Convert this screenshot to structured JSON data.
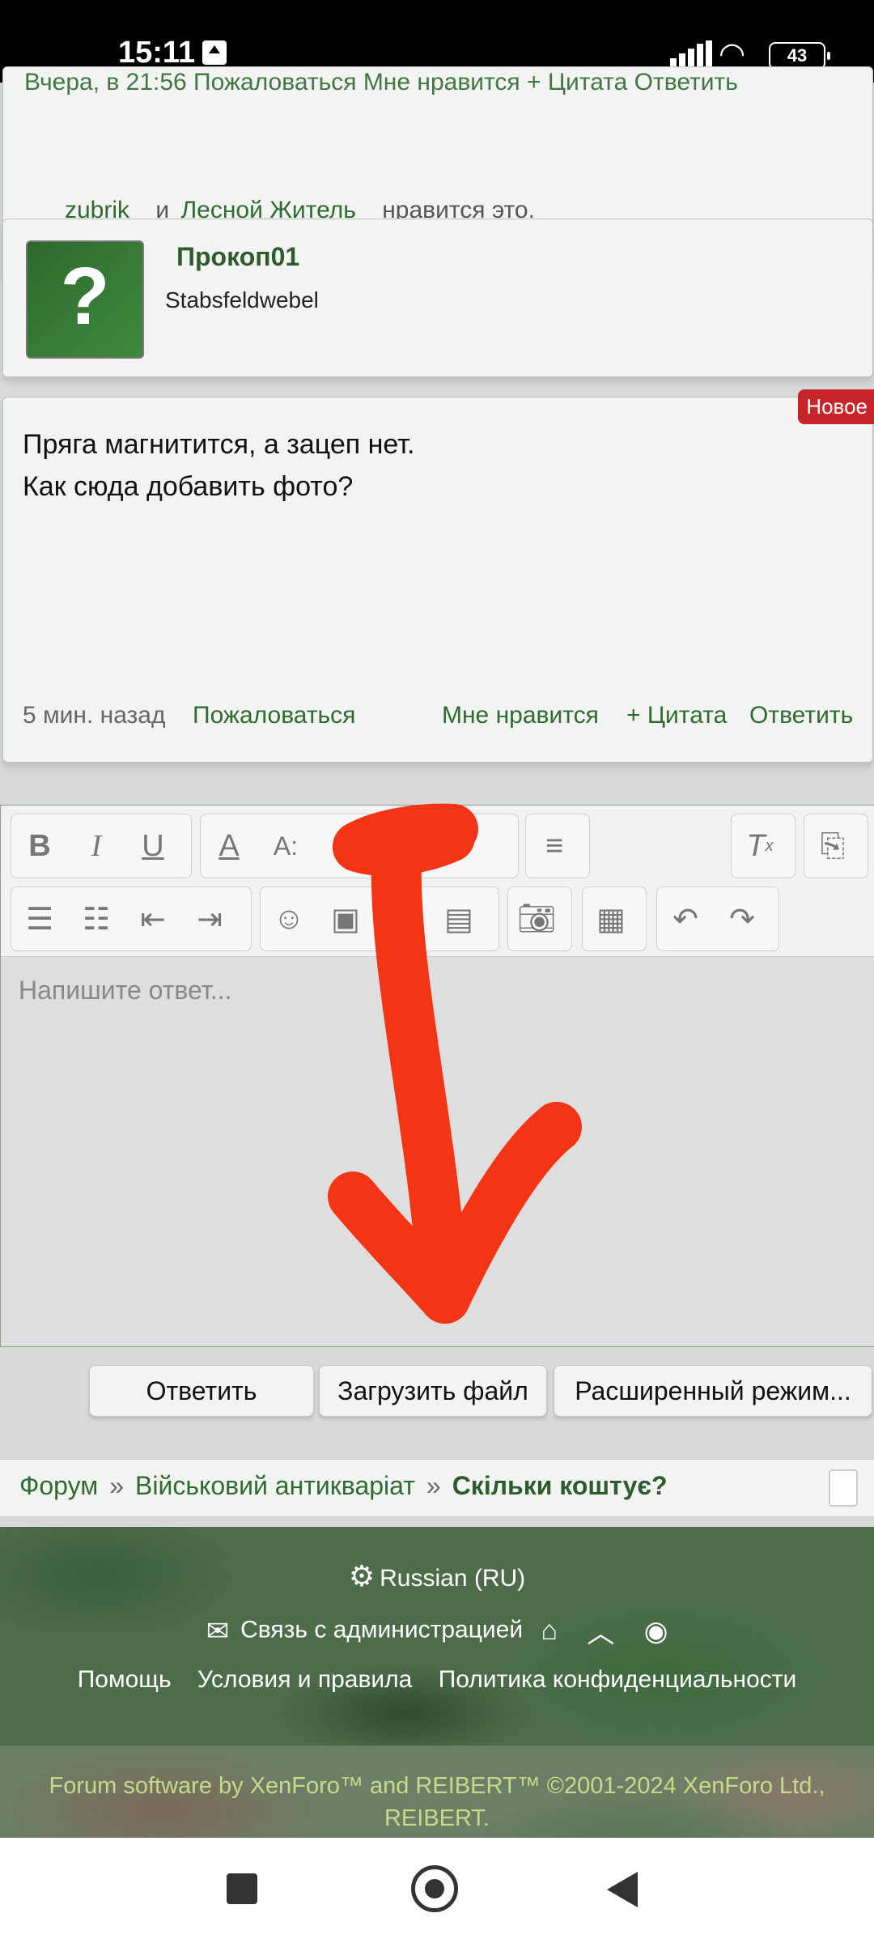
{
  "statusbar": {
    "time": "15:11",
    "battery": "43"
  },
  "likes": {
    "meta_cut": "Вчера, в 21:56   Пожаловаться        Мне нравится   + Цитата   Ответить",
    "user1": "zubrik",
    "joiner": "и",
    "user2": "Лесной Житель",
    "suffix": "нравится это."
  },
  "author": {
    "name": "Прокоп01",
    "title": "Stabsfeldwebel",
    "avatar_glyph": "?"
  },
  "post": {
    "badge": "Новое",
    "line1": "Пряга магнитится, а зацеп нет.",
    "line2": "Как сюда добавить фото?",
    "time": "5 мин. назад",
    "report": "Пожаловаться",
    "like": "Мне нравится",
    "quote": "+ Цитата",
    "reply": "Ответить"
  },
  "editor": {
    "placeholder": "Напишите ответ...",
    "toolbar_icons": [
      "bold-icon",
      "italic-icon",
      "underline-icon",
      "font-color-icon",
      "font-size-icon",
      "link-icon",
      "unlink-icon",
      "align-icon",
      "clear-format-icon",
      "source-icon",
      "bullet-list-icon",
      "numbered-list-icon",
      "outdent-icon",
      "indent-icon",
      "smiley-icon",
      "image-icon",
      "media-icon",
      "code-icon",
      "camera-icon",
      "save-icon",
      "undo-icon",
      "redo-icon"
    ]
  },
  "buttons": {
    "reply": "Ответить",
    "upload": "Загрузить файл",
    "advanced": "Расширенный режим..."
  },
  "breadcrumb": {
    "home": "Форум",
    "sep": "»",
    "section": "Військовий антикваріат",
    "current": "Скільки коштує?"
  },
  "footer": {
    "language": "Russian (RU)",
    "contact": "Связь с администрацией",
    "help": "Помощь",
    "terms": "Условия и правила",
    "privacy": "Политика конфиденциальности",
    "copyright1": "Forum software by XenForo™ and REIBERT™ ©2001-2024 XenForo Ltd.,",
    "copyright2": "REIBERT."
  },
  "colors": {
    "accent_green": "#2e6b2e",
    "badge_red": "#c8252a",
    "annotation_red": "#f33516"
  }
}
